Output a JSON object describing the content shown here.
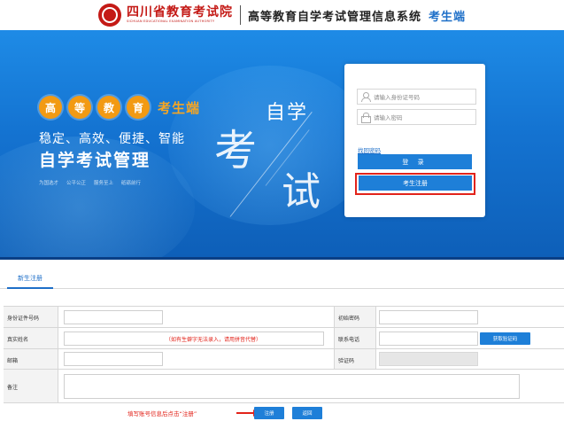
{
  "header": {
    "org_name": "四川省教育考试院",
    "org_name_en": "SICHUAN EDUCATIONAL EXAMINATION AUTHORITY",
    "system_name": "高等教育自学考试管理信息系统",
    "portal_name": "考生端"
  },
  "banner": {
    "dots": [
      "高",
      "等",
      "教",
      "育"
    ],
    "dots_label": "考生端",
    "tagline": "稳定、高效、便捷、智能",
    "headline": "自学考试管理",
    "slogans": [
      "为国选才",
      "公平公正",
      "服务至上",
      "砥砺前行"
    ],
    "big_kao": "考",
    "big_shi": "试",
    "big_zixue": "自学"
  },
  "login": {
    "id_placeholder": "请输入身份证号码",
    "password_placeholder": "请输入密码",
    "forgot_label": "找回密码",
    "login_label": "登 录",
    "register_label": "考生注册"
  },
  "form": {
    "tab_label": "新生注册",
    "id_label": "身份证件号码",
    "initial_password_label": "初始密码",
    "name_label": "真实姓名",
    "name_hint": "（如有生僻字无法录入，请用拼音代替）",
    "phone_label": "联系电话",
    "get_code_label": "获取验证码",
    "email_label": "邮箱",
    "code_label": "验证码",
    "remark_label": "备注",
    "instruction": "填写账号信息后点击“注册”",
    "register_label": "注册",
    "back_label": "返回"
  },
  "colors": {
    "accent_blue": "#1e7fd8",
    "brand_red": "#c41a16",
    "highlight_red": "#e2231a",
    "banner_orange": "#f29a13"
  }
}
